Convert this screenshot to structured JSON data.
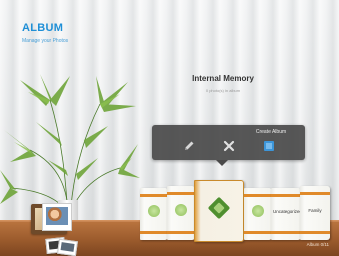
{
  "app": {
    "title": "ALBUM",
    "subtitle": "Manage your Photos"
  },
  "storage": {
    "title": "Internal Memory",
    "subtitle": "0 photo(s) in album"
  },
  "popup": {
    "create_label": "Create Album",
    "icons": [
      "pencil-icon",
      "close-icon",
      "new-album-icon"
    ]
  },
  "albums": [
    {
      "label": ""
    },
    {
      "label": ""
    },
    {
      "label": ""
    },
    {
      "label": ""
    },
    {
      "label": "Uncategorized"
    },
    {
      "label": "Family"
    }
  ],
  "status": {
    "text": "Album  0/11"
  },
  "colors": {
    "brand": "#1f8fd6",
    "accent_spine": "#e08a2a",
    "popup_bg": "#4a4a4a",
    "shelf": "#9a5a2c"
  }
}
